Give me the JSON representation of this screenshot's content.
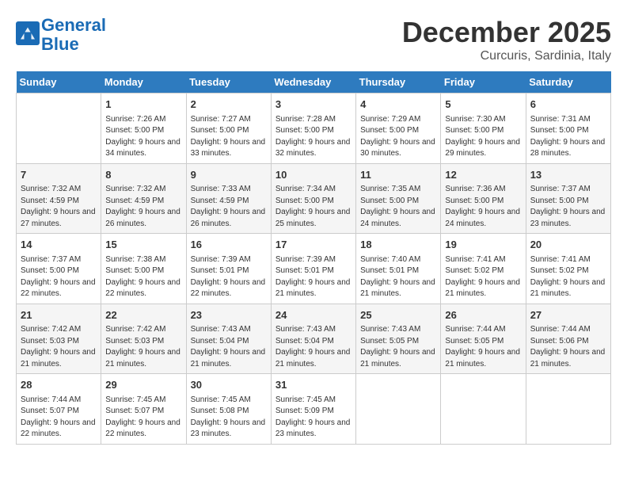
{
  "logo": {
    "line1": "General",
    "line2": "Blue"
  },
  "title": "December 2025",
  "location": "Curcuris, Sardinia, Italy",
  "days_of_week": [
    "Sunday",
    "Monday",
    "Tuesday",
    "Wednesday",
    "Thursday",
    "Friday",
    "Saturday"
  ],
  "weeks": [
    [
      {
        "date": "",
        "info": ""
      },
      {
        "date": "1",
        "sunrise": "7:26 AM",
        "sunset": "5:00 PM",
        "daylight": "9 hours and 34 minutes."
      },
      {
        "date": "2",
        "sunrise": "7:27 AM",
        "sunset": "5:00 PM",
        "daylight": "9 hours and 33 minutes."
      },
      {
        "date": "3",
        "sunrise": "7:28 AM",
        "sunset": "5:00 PM",
        "daylight": "9 hours and 32 minutes."
      },
      {
        "date": "4",
        "sunrise": "7:29 AM",
        "sunset": "5:00 PM",
        "daylight": "9 hours and 30 minutes."
      },
      {
        "date": "5",
        "sunrise": "7:30 AM",
        "sunset": "5:00 PM",
        "daylight": "9 hours and 29 minutes."
      },
      {
        "date": "6",
        "sunrise": "7:31 AM",
        "sunset": "5:00 PM",
        "daylight": "9 hours and 28 minutes."
      }
    ],
    [
      {
        "date": "7",
        "sunrise": "7:32 AM",
        "sunset": "4:59 PM",
        "daylight": "9 hours and 27 minutes."
      },
      {
        "date": "8",
        "sunrise": "7:32 AM",
        "sunset": "4:59 PM",
        "daylight": "9 hours and 26 minutes."
      },
      {
        "date": "9",
        "sunrise": "7:33 AM",
        "sunset": "4:59 PM",
        "daylight": "9 hours and 26 minutes."
      },
      {
        "date": "10",
        "sunrise": "7:34 AM",
        "sunset": "5:00 PM",
        "daylight": "9 hours and 25 minutes."
      },
      {
        "date": "11",
        "sunrise": "7:35 AM",
        "sunset": "5:00 PM",
        "daylight": "9 hours and 24 minutes."
      },
      {
        "date": "12",
        "sunrise": "7:36 AM",
        "sunset": "5:00 PM",
        "daylight": "9 hours and 24 minutes."
      },
      {
        "date": "13",
        "sunrise": "7:37 AM",
        "sunset": "5:00 PM",
        "daylight": "9 hours and 23 minutes."
      }
    ],
    [
      {
        "date": "14",
        "sunrise": "7:37 AM",
        "sunset": "5:00 PM",
        "daylight": "9 hours and 22 minutes."
      },
      {
        "date": "15",
        "sunrise": "7:38 AM",
        "sunset": "5:00 PM",
        "daylight": "9 hours and 22 minutes."
      },
      {
        "date": "16",
        "sunrise": "7:39 AM",
        "sunset": "5:01 PM",
        "daylight": "9 hours and 22 minutes."
      },
      {
        "date": "17",
        "sunrise": "7:39 AM",
        "sunset": "5:01 PM",
        "daylight": "9 hours and 21 minutes."
      },
      {
        "date": "18",
        "sunrise": "7:40 AM",
        "sunset": "5:01 PM",
        "daylight": "9 hours and 21 minutes."
      },
      {
        "date": "19",
        "sunrise": "7:41 AM",
        "sunset": "5:02 PM",
        "daylight": "9 hours and 21 minutes."
      },
      {
        "date": "20",
        "sunrise": "7:41 AM",
        "sunset": "5:02 PM",
        "daylight": "9 hours and 21 minutes."
      }
    ],
    [
      {
        "date": "21",
        "sunrise": "7:42 AM",
        "sunset": "5:03 PM",
        "daylight": "9 hours and 21 minutes."
      },
      {
        "date": "22",
        "sunrise": "7:42 AM",
        "sunset": "5:03 PM",
        "daylight": "9 hours and 21 minutes."
      },
      {
        "date": "23",
        "sunrise": "7:43 AM",
        "sunset": "5:04 PM",
        "daylight": "9 hours and 21 minutes."
      },
      {
        "date": "24",
        "sunrise": "7:43 AM",
        "sunset": "5:04 PM",
        "daylight": "9 hours and 21 minutes."
      },
      {
        "date": "25",
        "sunrise": "7:43 AM",
        "sunset": "5:05 PM",
        "daylight": "9 hours and 21 minutes."
      },
      {
        "date": "26",
        "sunrise": "7:44 AM",
        "sunset": "5:05 PM",
        "daylight": "9 hours and 21 minutes."
      },
      {
        "date": "27",
        "sunrise": "7:44 AM",
        "sunset": "5:06 PM",
        "daylight": "9 hours and 21 minutes."
      }
    ],
    [
      {
        "date": "28",
        "sunrise": "7:44 AM",
        "sunset": "5:07 PM",
        "daylight": "9 hours and 22 minutes."
      },
      {
        "date": "29",
        "sunrise": "7:45 AM",
        "sunset": "5:07 PM",
        "daylight": "9 hours and 22 minutes."
      },
      {
        "date": "30",
        "sunrise": "7:45 AM",
        "sunset": "5:08 PM",
        "daylight": "9 hours and 23 minutes."
      },
      {
        "date": "31",
        "sunrise": "7:45 AM",
        "sunset": "5:09 PM",
        "daylight": "9 hours and 23 minutes."
      },
      {
        "date": "",
        "info": ""
      },
      {
        "date": "",
        "info": ""
      },
      {
        "date": "",
        "info": ""
      }
    ]
  ]
}
